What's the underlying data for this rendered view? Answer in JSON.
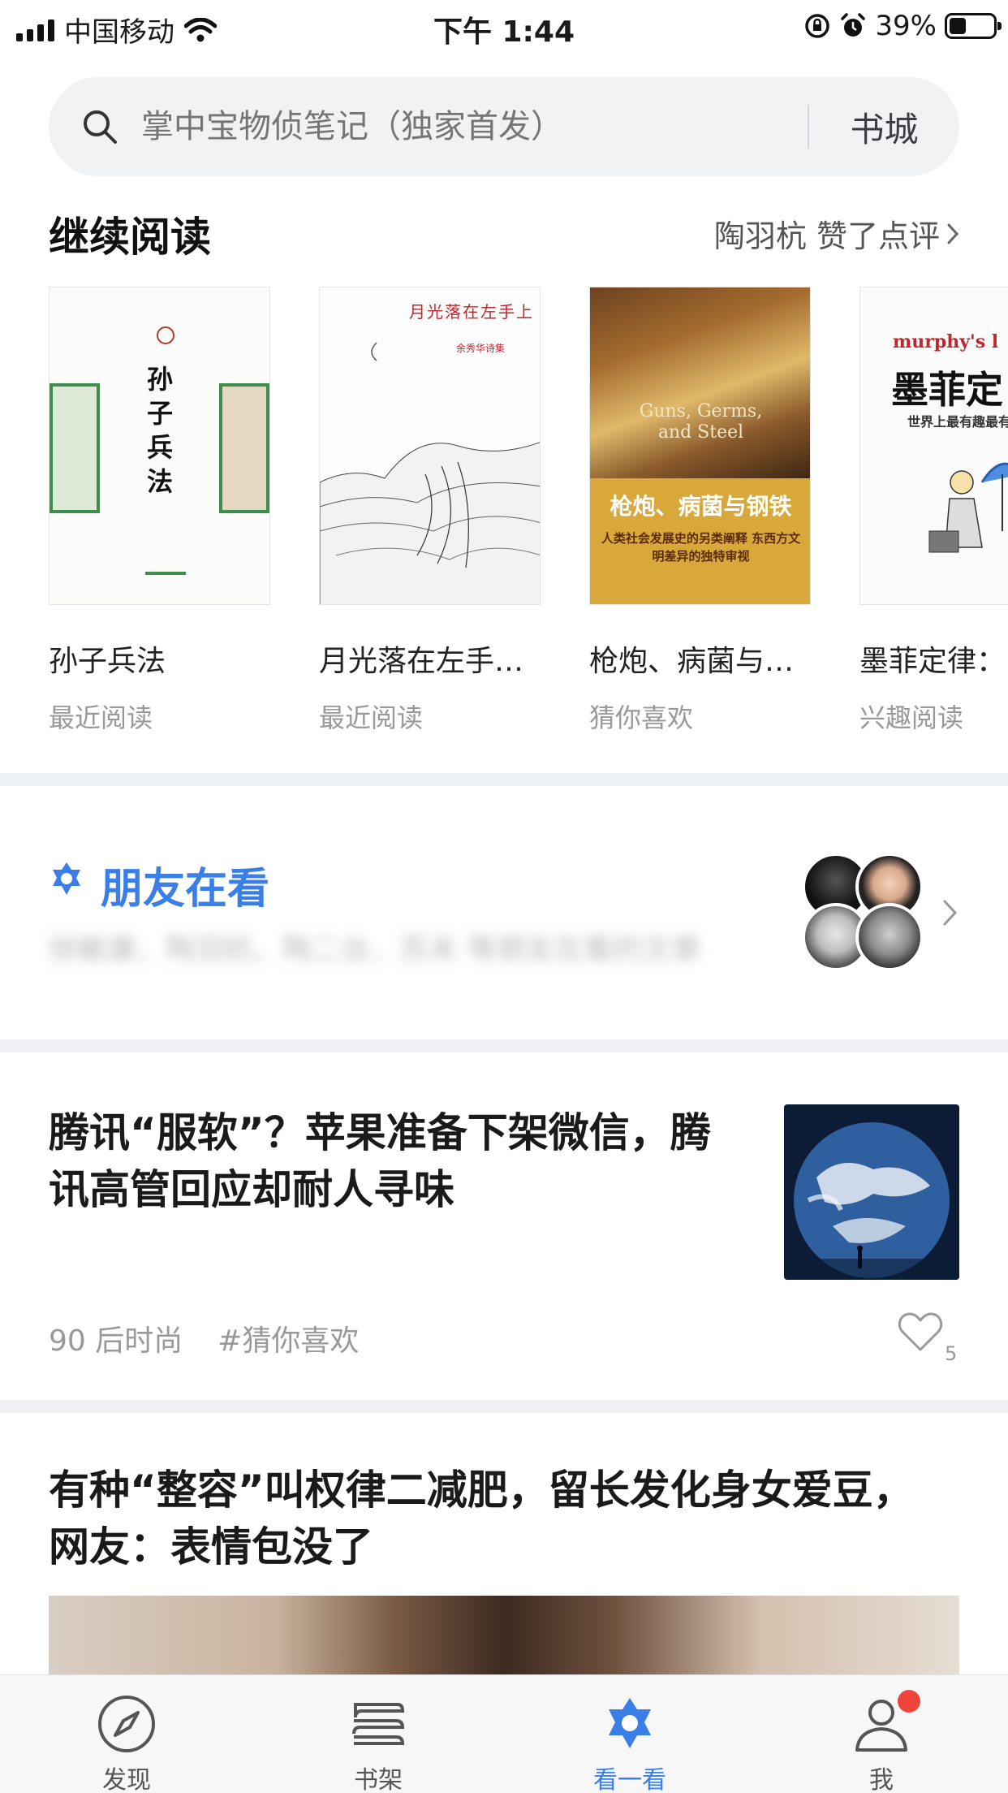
{
  "status_bar": {
    "carrier": "中国移动",
    "time": "下午 1:44",
    "battery": "39%",
    "battery_level": 0.39
  },
  "search": {
    "placeholder": "掌中宝物侦笔记（独家首发）",
    "store_label": "书城"
  },
  "continue_reading": {
    "title": "继续阅读",
    "hint": "陶羽杭 赞了点评",
    "books": [
      {
        "title": "孙子兵法",
        "subtitle": "最近阅读",
        "cover_text": "孙子兵法"
      },
      {
        "title": "月光落在左手…",
        "subtitle": "最近阅读",
        "cover_text": "月光落在左手上",
        "cover_sub": "余秀华诗集"
      },
      {
        "title": "枪炮、病菌与…",
        "subtitle": "猜你喜欢",
        "cover_text": "枪炮、病菌与钢铁",
        "cover_en": "Guns, Germs, and Steel",
        "cover_sub": "人类社会发展史的另类阐释 东西方文明差异的独特审视"
      },
      {
        "title": "墨菲定律：",
        "subtitle": "兴趣阅读",
        "cover_text": "墨菲定",
        "cover_en": "murphy's l",
        "cover_sub": "世界上最有趣最有用"
      }
    ]
  },
  "friends": {
    "title": "朋友在看",
    "blurred_text": "徐敏康、陶羽杭、陶二台、苏未 等朋友在看的文章"
  },
  "articles": [
    {
      "title_line1": "腾讯“服软”？苹果准备下架微信，腾",
      "title_line2": "讯高管回应却耐人寻味",
      "source": "90 后时尚",
      "tag": "#猜你喜欢",
      "likes": "5"
    },
    {
      "title_line1": "有种“整容”叫权律二减肥，留长发化身女爱豆，",
      "title_line2": "网友：表情包没了"
    }
  ],
  "tabs": [
    {
      "label": "发现",
      "icon": "compass-icon"
    },
    {
      "label": "书架",
      "icon": "bookshelf-icon"
    },
    {
      "label": "看一看",
      "icon": "look-icon"
    },
    {
      "label": "我",
      "icon": "profile-icon"
    }
  ],
  "colors": {
    "accent": "#3a7ee8",
    "badge": "#f0443b"
  }
}
